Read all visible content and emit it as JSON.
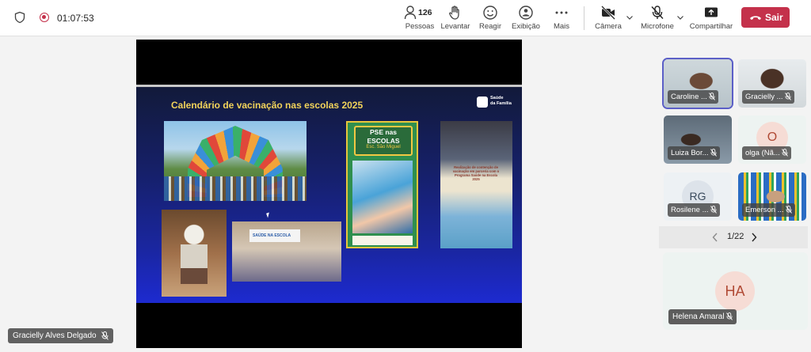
{
  "meeting": {
    "timer": "01:07:53",
    "toolbar": {
      "people_count": "126",
      "people_label": "Pessoas",
      "raise_label": "Levantar",
      "react_label": "Reagir",
      "view_label": "Exibição",
      "more_label": "Mais",
      "camera_label": "Câmera",
      "mic_label": "Microfone",
      "share_label": "Compartilhar",
      "leave_label": "Sair"
    }
  },
  "slide": {
    "title": "Calendário de vacinação nas escolas  2025",
    "brand_line1": "Saúde",
    "brand_line2": "da Família",
    "pse_title_1": "PSE nas",
    "pse_title_2": "ESCOLAS",
    "pse_school": "Esc. São Miguel",
    "pse_city": "Conceição",
    "banner_text": "SAÚDE NA ESCOLA",
    "note_text": "Realização de contenção de vacinação em parceria com o Programa Saúde na Escola 2025"
  },
  "presenter_badge": "Gracielly Alves Delgado",
  "participants": [
    {
      "name": "Caroline ..."
    },
    {
      "name": "Gracielly ..."
    },
    {
      "name": "Luiza Bor..."
    },
    {
      "name": "olga (Nã...",
      "initials": "O"
    },
    {
      "name": "Rosilene ...",
      "initials": "RG"
    },
    {
      "name": "Emerson ..."
    }
  ],
  "pager": {
    "text": "1/22"
  },
  "featured": {
    "name": "Helena Amaral",
    "initials": "HA"
  },
  "colors": {
    "accent": "#5b5fc7",
    "leave": "#c4314b",
    "slide_title": "#f2d35a"
  }
}
